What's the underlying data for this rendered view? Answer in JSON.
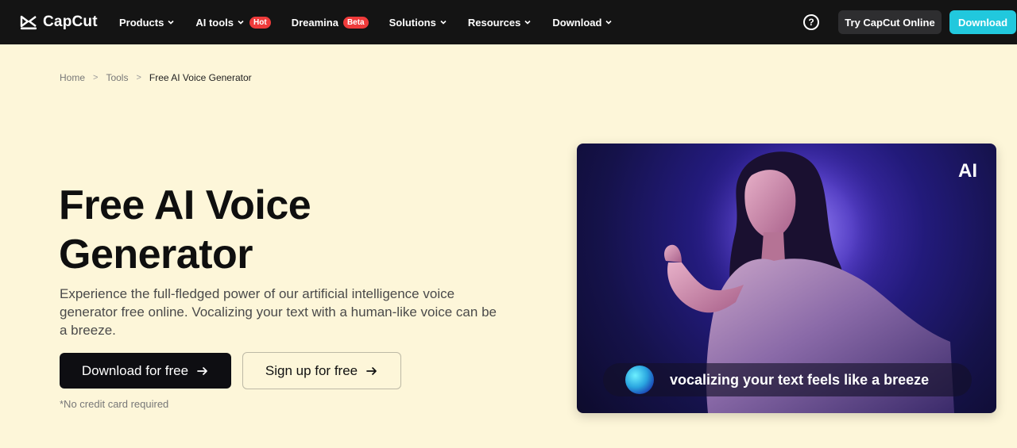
{
  "brand": {
    "name": "CapCut"
  },
  "nav": {
    "items": [
      {
        "label": "Products",
        "badge": null,
        "has_chevron": true
      },
      {
        "label": "AI tools",
        "badge": "Hot",
        "has_chevron": true
      },
      {
        "label": "Dreamina",
        "badge": "Beta",
        "has_chevron": false
      },
      {
        "label": "Solutions",
        "badge": null,
        "has_chevron": true
      },
      {
        "label": "Resources",
        "badge": null,
        "has_chevron": true
      },
      {
        "label": "Download",
        "badge": null,
        "has_chevron": true
      }
    ],
    "help_icon": "question-circle-icon",
    "help_glyph": "?",
    "try_online_label": "Try CapCut Online",
    "download_label": "Download"
  },
  "breadcrumb": {
    "home": "Home",
    "tools": "Tools",
    "current": "Free AI Voice Generator",
    "separator": ">"
  },
  "hero": {
    "title_line1": "Free AI Voice",
    "title_line2": "Generator",
    "description": "Experience the full-fledged power of our artificial intelligence voice generator free online. Vocalizing your text with a human-like voice can be a breeze.",
    "primary_cta": "Download for free",
    "secondary_cta": "Sign up for free",
    "note": "*No credit card required"
  },
  "media": {
    "tag": "AI",
    "caption": "vocalizing your text feels like a breeze"
  },
  "colors": {
    "nav_bg": "#141414",
    "page_bg": "#fdf6d9",
    "accent": "#21c8dd",
    "badge": "#ef3b3b",
    "primary_button": "#0e0e12"
  }
}
